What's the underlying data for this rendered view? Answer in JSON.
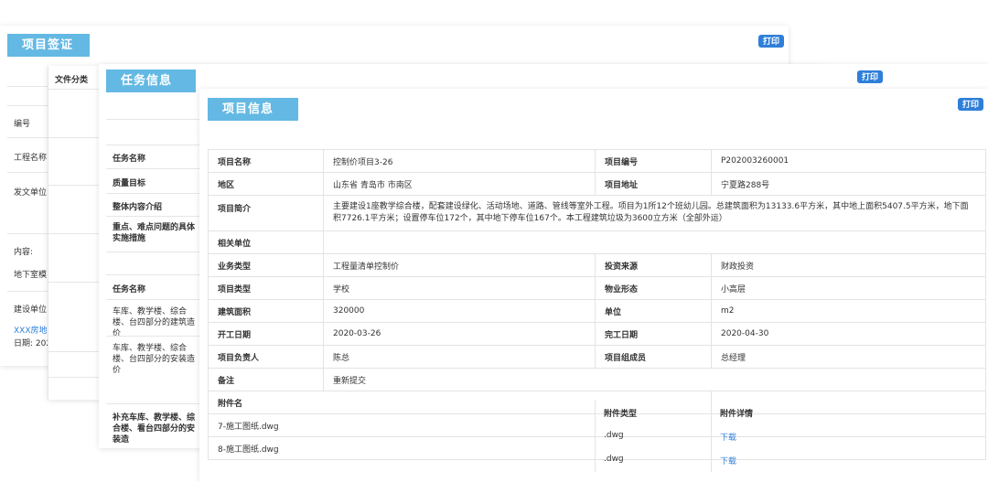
{
  "visa_panel": {
    "title": "项目签证",
    "print": "打印",
    "fields": [
      "编号",
      "工程名称",
      "发文单位",
      "内容:",
      "地下室模",
      "建设单位"
    ],
    "link_text": "XXX房地",
    "date_text": "日期: 202"
  },
  "doc_panel": {
    "category_header": "文件分类"
  },
  "task_panel": {
    "title": "任务信息",
    "print": "打印",
    "rows": [
      "任务名称",
      "质量目标",
      "整体内容介绍",
      "重点、难点问题的具体实施措施",
      "任务名称"
    ],
    "list_items": [
      "车库、教学楼、综合楼、台四部分的建筑造价",
      "车库、教学楼、综合楼、台四部分的安装造价"
    ],
    "bottom_item": "补充车库、教学楼、综合楼、看台四部分的安装造"
  },
  "project_panel": {
    "title": "项目信息",
    "print": "打印",
    "rows": [
      {
        "k1": "项目名称",
        "v1": "控制价项目3-26",
        "k2": "项目编号",
        "v2": "P202003260001"
      },
      {
        "k1": "地区",
        "v1": "山东省 青岛市 市南区",
        "k2": "项目地址",
        "v2": "宁夏路288号"
      }
    ],
    "intro_label": "项目简介",
    "intro_text": "主要建设1座教学综合楼，配套建设绿化、活动场地、道路、管线等室外工程。项目为1所12个班幼儿园。总建筑面积为13133.6平方米，其中地上面积5407.5平方米，地下面积7726.1平方米；设置停车位172个，其中地下停车位167个。本工程建筑垃圾为3600立方米（全部外运）",
    "related_label": "相关单位",
    "rows2": [
      {
        "k1": "业务类型",
        "v1": "工程量清单控制价",
        "k2": "投资来源",
        "v2": "财政投资"
      },
      {
        "k1": "项目类型",
        "v1": "学校",
        "k2": "物业形态",
        "v2": "小高层"
      },
      {
        "k1": "建筑面积",
        "v1": "320000",
        "k2": "单位",
        "v2": "m2"
      },
      {
        "k1": "开工日期",
        "v1": "2020-03-26",
        "k2": "完工日期",
        "v2": "2020-04-30"
      },
      {
        "k1": "项目负责人",
        "v1": "陈总",
        "k2": "项目组成员",
        "v2": "总经理"
      }
    ],
    "remark_label": "备注",
    "remark_value": "重新提交",
    "attach_headers": {
      "name": "附件名",
      "type": "附件类型",
      "detail": "附件详情"
    },
    "attachments": [
      {
        "name": "7-施工图纸.dwg",
        "type": ".dwg",
        "action": "下载"
      },
      {
        "name": "8-施工图纸.dwg",
        "type": ".dwg",
        "action": "下载"
      }
    ]
  }
}
